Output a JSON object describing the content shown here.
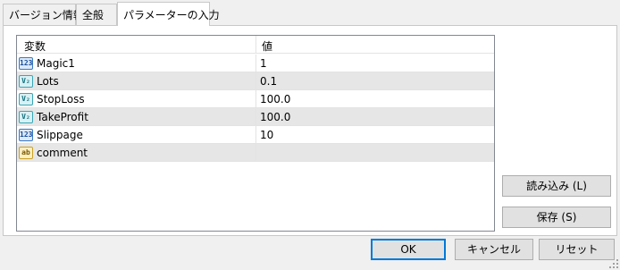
{
  "tabs": [
    {
      "label": "バージョン情報"
    },
    {
      "label": "全般"
    },
    {
      "label": "パラメーターの入力"
    }
  ],
  "grid": {
    "headers": {
      "name": "変数",
      "value": "値"
    },
    "rows": [
      {
        "name": "Magic1",
        "value": "1",
        "type_icon": "int-type-icon",
        "badge": "123"
      },
      {
        "name": "Lots",
        "value": "0.1",
        "type_icon": "double-type-icon",
        "badge": "V₂"
      },
      {
        "name": "StopLoss",
        "value": "100.0",
        "type_icon": "double-type-icon",
        "badge": "V₂"
      },
      {
        "name": "TakeProfit",
        "value": "100.0",
        "type_icon": "double-type-icon",
        "badge": "V₂"
      },
      {
        "name": "Slippage",
        "value": "10",
        "type_icon": "int-type-icon",
        "badge": "123"
      },
      {
        "name": "comment",
        "value": "",
        "type_icon": "string-type-icon",
        "badge": "ab"
      }
    ]
  },
  "buttons": {
    "load": "読み込み (L)",
    "save": "保存 (S)",
    "ok": "OK",
    "cancel": "キャンセル",
    "reset": "リセット"
  },
  "colors": {
    "accent": "#0078d7",
    "row_alt": "#e6e6e6",
    "panel_bg": "#ffffff",
    "window_bg": "#f0f0f0"
  }
}
